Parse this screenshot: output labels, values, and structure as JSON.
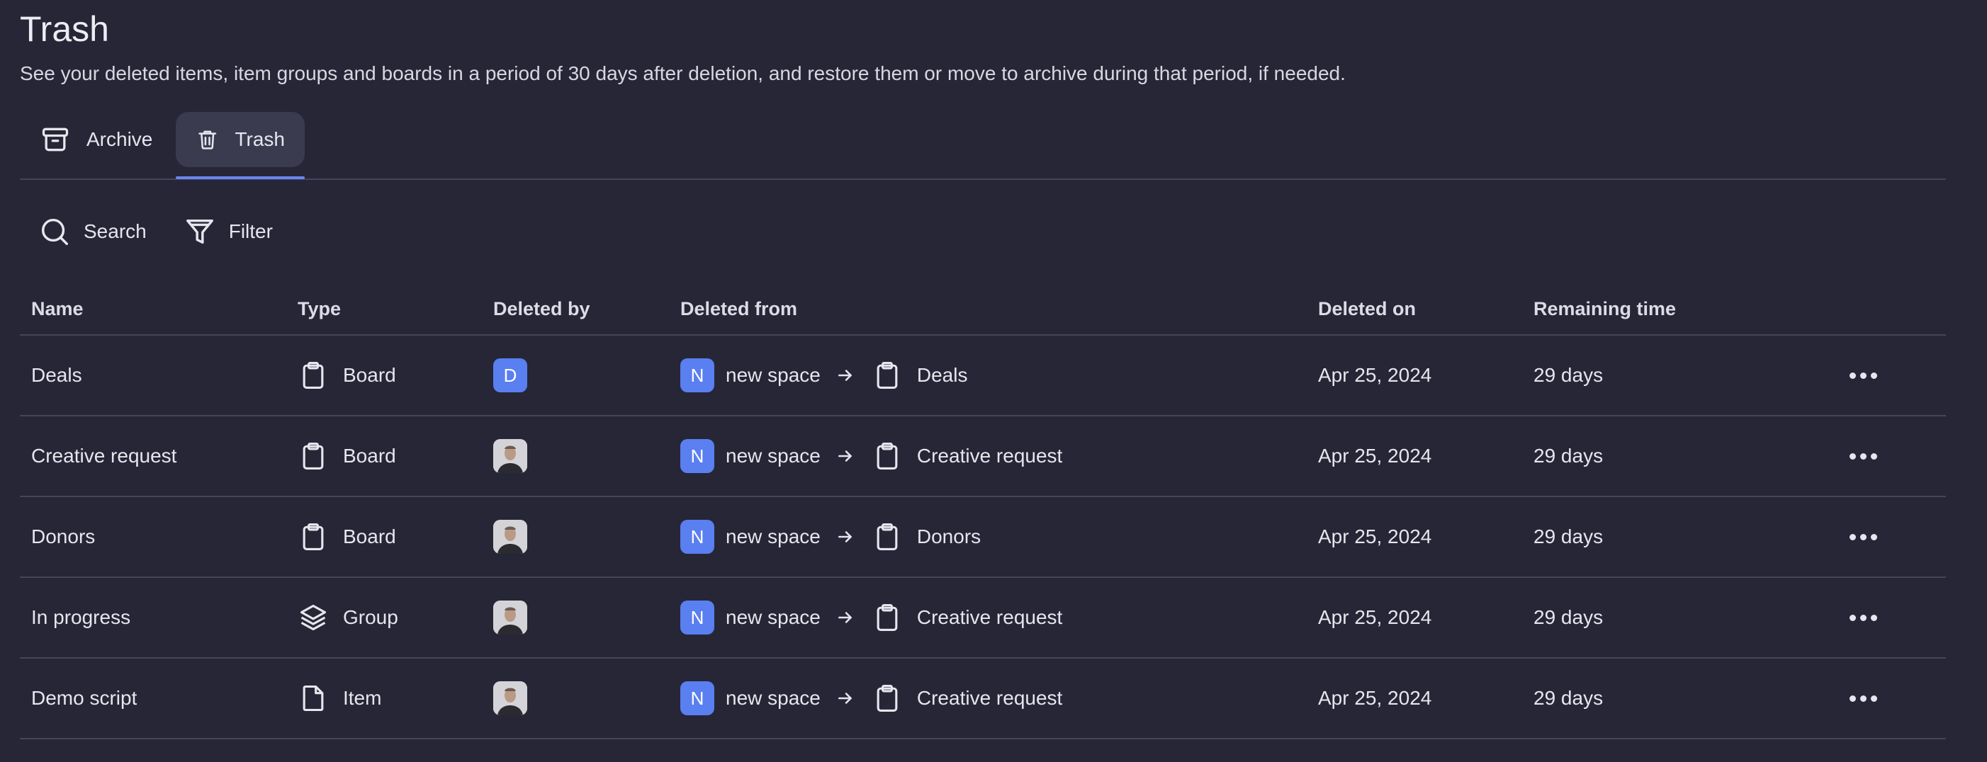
{
  "page": {
    "title": "Trash",
    "subtitle": "See your deleted items, item groups and boards in a period of 30 days after deletion, and restore them or move to archive during that period, if needed."
  },
  "tabs": [
    {
      "label": "Archive",
      "icon": "archive-icon",
      "active": false
    },
    {
      "label": "Trash",
      "icon": "trash-icon",
      "active": true
    }
  ],
  "toolbar": {
    "search_label": "Search",
    "filter_label": "Filter"
  },
  "table": {
    "columns": [
      "Name",
      "Type",
      "Deleted by",
      "Deleted from",
      "Deleted on",
      "Remaining time"
    ],
    "rows": [
      {
        "name": "Deals",
        "type": "Board",
        "type_icon": "clipboard-icon",
        "deleted_by": "D",
        "deleted_by_kind": "initial",
        "space_initial": "N",
        "space": "new space",
        "board": "Deals",
        "deleted_on": "Apr 25, 2024",
        "remaining": "29 days"
      },
      {
        "name": "Creative request",
        "type": "Board",
        "type_icon": "clipboard-icon",
        "deleted_by": "",
        "deleted_by_kind": "photo",
        "space_initial": "N",
        "space": "new space",
        "board": "Creative request",
        "deleted_on": "Apr 25, 2024",
        "remaining": "29 days"
      },
      {
        "name": "Donors",
        "type": "Board",
        "type_icon": "clipboard-icon",
        "deleted_by": "",
        "deleted_by_kind": "photo",
        "space_initial": "N",
        "space": "new space",
        "board": "Donors",
        "deleted_on": "Apr 25, 2024",
        "remaining": "29 days"
      },
      {
        "name": "In progress",
        "type": "Group",
        "type_icon": "layers-icon",
        "deleted_by": "",
        "deleted_by_kind": "photo",
        "space_initial": "N",
        "space": "new space",
        "board": "Creative request",
        "deleted_on": "Apr 25, 2024",
        "remaining": "29 days"
      },
      {
        "name": "Demo script",
        "type": "Item",
        "type_icon": "file-icon",
        "deleted_by": "",
        "deleted_by_kind": "photo",
        "space_initial": "N",
        "space": "new space",
        "board": "Creative request",
        "deleted_on": "Apr 25, 2024",
        "remaining": "29 days"
      }
    ]
  },
  "colors": {
    "background": "#262637",
    "accent": "#6b86f0",
    "badge": "#5a7ff0",
    "divider": "#45455a"
  }
}
